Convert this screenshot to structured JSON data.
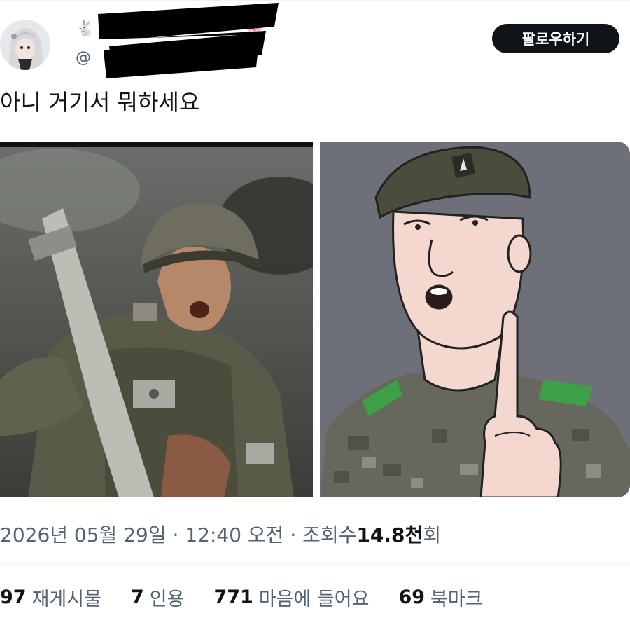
{
  "post": {
    "text": "아니 거기서 뭐하세요",
    "author": {
      "name_emoji_left": "🐇",
      "name_emoji_right": "🌸",
      "handle_prefix": "@"
    }
  },
  "actions": {
    "follow_label": "팔로우하기"
  },
  "meta": {
    "date": "2026년 05월 29일",
    "dot1": "·",
    "time": "12:40 오전",
    "dot2": "·",
    "views_label": "조회수",
    "views_value": "14.8천",
    "views_suffix": "회"
  },
  "stats": [
    {
      "value": "97",
      "label": "재게시물"
    },
    {
      "value": "7",
      "label": "인용"
    },
    {
      "value": "771",
      "label": "마음에 들어요"
    },
    {
      "value": "69",
      "label": "북마크"
    }
  ],
  "colors": {
    "text_primary": "#0f1419",
    "text_secondary": "#536471",
    "follow_bg": "#0f1419",
    "divider": "#eff3f4"
  }
}
